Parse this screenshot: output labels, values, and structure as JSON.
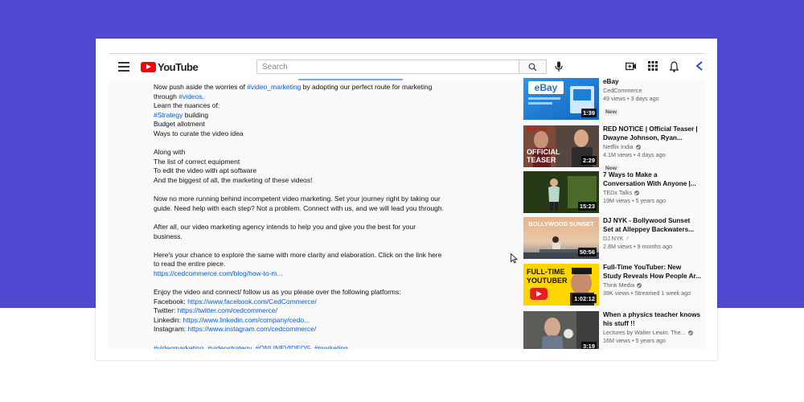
{
  "header": {
    "logo_text": "YouTube",
    "search_placeholder": "Search"
  },
  "description": {
    "lines": [
      {
        "pre": "Now push aside the worries of ",
        "link": "#video_marketing",
        "post": " by adopting our perfect route for marketing"
      },
      {
        "pre": "through ",
        "link": "#videos",
        "post": "."
      },
      {
        "text": "Learn the nuances of:"
      },
      {
        "link": "#Strategy",
        "post": " building"
      },
      {
        "text": "Budget allotment"
      },
      {
        "text": "Ways to curate the video idea"
      },
      {
        "text": ""
      },
      {
        "text": "Along with"
      },
      {
        "text": "The list of correct equipment"
      },
      {
        "text": "To edit the video with apt software"
      },
      {
        "text": "And the biggest of all, the marketing of these videos!"
      },
      {
        "text": ""
      },
      {
        "text": "Now no more running behind incompetent video marketing. Set your journey right by taking our"
      },
      {
        "text": "guide. Need help with each step? Not a problem. Connect with us, and we will lead you through."
      },
      {
        "text": ""
      },
      {
        "text": "After all, our video marketing agency intends to help you and give you the best for your"
      },
      {
        "text": "business."
      },
      {
        "text": ""
      },
      {
        "text": "Here's your chance to explore the same with more clarity and elaboration. Click on the link here"
      },
      {
        "text": "to read the entire piece."
      },
      {
        "link": "https://cedcommerce.com/blog/how-to-m..."
      },
      {
        "text": ""
      },
      {
        "text": "Enjoy the video and connect/ follow us as you please over the following platforms:"
      },
      {
        "pre": "Facebook: ",
        "link": "https://www.facebook.com/CedCommerce/"
      },
      {
        "pre": "Twitter: ",
        "link": "https://twitter.com/cedcommerce/"
      },
      {
        "pre": "Linkedin: ",
        "link": "https://www.linkedin.com/company/cedo..."
      },
      {
        "pre": "Instagram: ",
        "link": "https://www.instagram.com/cedcommerce/"
      },
      {
        "text": ""
      },
      {
        "hashtags": [
          "#videomarketing",
          "#videostrategy",
          "#ONLINEVIDEOS",
          "#marketing"
        ]
      }
    ]
  },
  "videos": [
    {
      "title1": "eBay",
      "title2": "",
      "channel": "CedCommerce",
      "verified": false,
      "stats": "49 views • 3 days ago",
      "badge": "New",
      "duration": "1:39",
      "thumb": "ebay",
      "thumb_text": "eBay"
    },
    {
      "title1": "RED NOTICE | Official Teaser |",
      "title2": "Dwayne Johnson, Ryan...",
      "channel": "Netflix India",
      "verified": true,
      "stats": "4.1M views • 4 days ago",
      "badge": "New",
      "duration": "2:29",
      "thumb": "netflix",
      "thumb_text": "OFFICIAL TEASER"
    },
    {
      "title1": "7 Ways to Make a",
      "title2": "Conversation With Anyone |...",
      "channel": "TEDx Talks",
      "verified": true,
      "stats": "19M views • 5 years ago",
      "badge": "",
      "duration": "15:23",
      "thumb": "tedx",
      "thumb_text": ""
    },
    {
      "title1": "DJ NYK - Bollywood Sunset",
      "title2": "Set at Alleppey Backwaters...",
      "channel": "DJ NYK",
      "verified": false,
      "music": true,
      "stats": "2.8M views • 9 months ago",
      "badge": "",
      "duration": "50:56",
      "thumb": "sunset",
      "thumb_text": "BOLLYWOOD SUNSET"
    },
    {
      "title1": "Full-Time YouTuber: New",
      "title2": "Study Reveals How People Ar...",
      "channel": "Think Media",
      "verified": true,
      "stats": "39K views • Streamed 1 week ago",
      "badge": "",
      "duration": "1:02:12",
      "thumb": "youtuber",
      "thumb_text": "FULL-TIME YOUTUBER"
    },
    {
      "title1": "When a physics teacher knows",
      "title2": "his stuff !!",
      "channel": "Lectures by Walter Lewin. The...",
      "verified": true,
      "stats": "16M views • 5 years ago",
      "badge": "",
      "duration": "3:19",
      "thumb": "physics",
      "thumb_text": ""
    }
  ]
}
